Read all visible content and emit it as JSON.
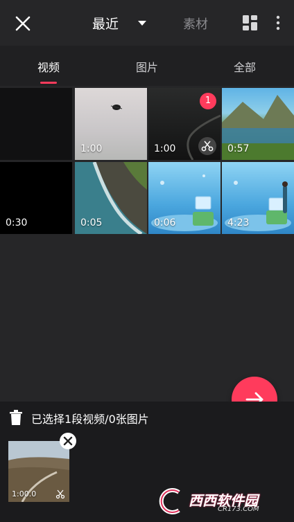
{
  "header": {
    "title": "最近",
    "material_label": "素材"
  },
  "tabs": [
    {
      "label": "视频",
      "active": true
    },
    {
      "label": "图片",
      "active": false
    },
    {
      "label": "全部",
      "active": false
    }
  ],
  "grid": {
    "items": [
      {
        "duration": "",
        "scene": "black"
      },
      {
        "duration": "1:00",
        "scene": "fog"
      },
      {
        "duration": "1:00",
        "scene": "dark-road",
        "selected_index": "1"
      },
      {
        "duration": "0:57",
        "scene": "mountain-lake"
      },
      {
        "duration": "0:30",
        "scene": "black"
      },
      {
        "duration": "0:05",
        "scene": "coast"
      },
      {
        "duration": "0:06",
        "scene": "animated-blue"
      },
      {
        "duration": "4:23",
        "scene": "animated-blue-person"
      }
    ]
  },
  "selection": {
    "summary": "已选择1段视频/0张图片",
    "item_duration": "1:00.0"
  },
  "watermark": {
    "brand": "西西软件园",
    "domain": "CR173.COM"
  },
  "colors": {
    "accent": "#ff3b5c",
    "background": "#262628"
  }
}
